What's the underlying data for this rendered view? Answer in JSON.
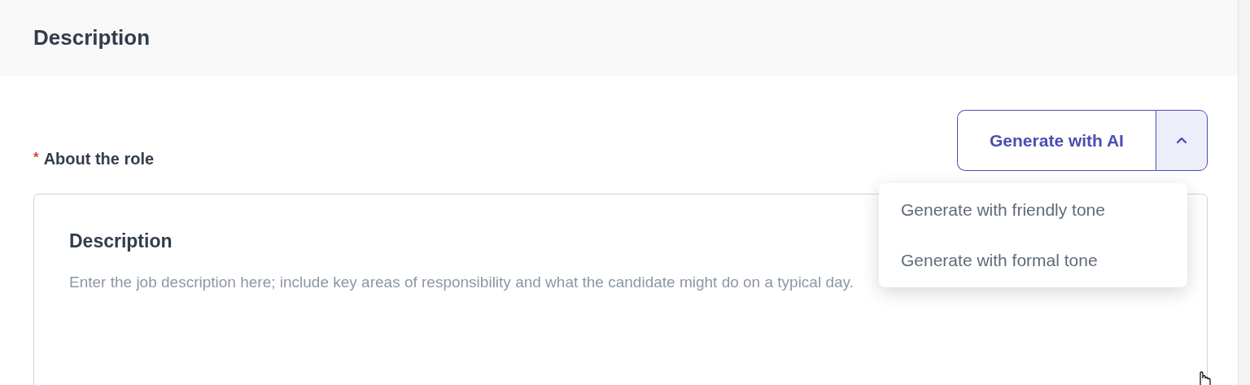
{
  "section": {
    "title": "Description"
  },
  "field": {
    "label": "About the role",
    "required": true,
    "required_mark": "*"
  },
  "generate_button": {
    "label": "Generate with AI",
    "expanded": true
  },
  "menu": [
    {
      "label": "Generate with friendly tone",
      "selected": false
    },
    {
      "label": "Generate with formal tone",
      "selected": false
    }
  ],
  "editor": {
    "heading": "Description",
    "placeholder": "Enter the job description here; include key areas of responsibility and what the candidate might do on a typical day."
  }
}
